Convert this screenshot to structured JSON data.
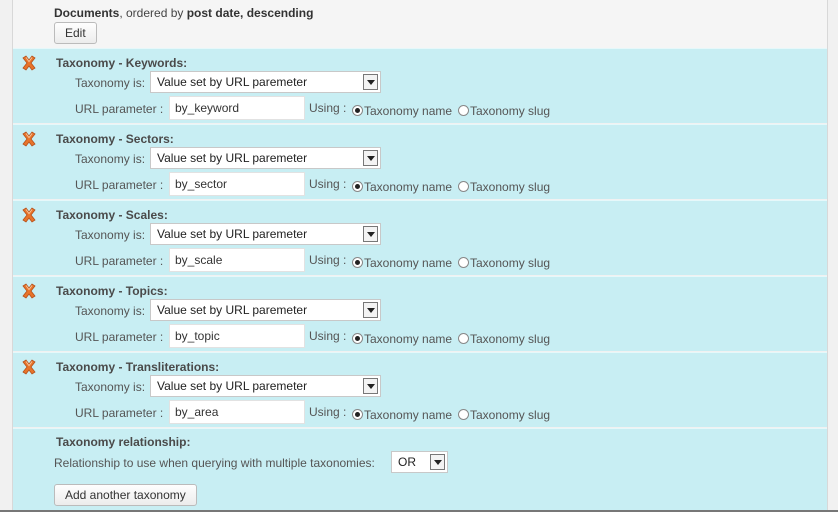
{
  "summary": {
    "post_type": "Documents",
    "ordered_by_text": ", ordered by ",
    "order_field": "post date, descending",
    "edit_label": "Edit"
  },
  "labels": {
    "taxonomy_is": "Taxonomy is:",
    "url_parameter": "URL parameter :",
    "using": "Using :",
    "taxonomy_name": "Taxonomy name",
    "taxonomy_slug": "Taxonomy slug"
  },
  "taxonomies": [
    {
      "title": "Taxonomy - Keywords:",
      "select_value": "Value set by URL paremeter",
      "url_param": "by_keyword",
      "using": "name"
    },
    {
      "title": "Taxonomy - Sectors:",
      "select_value": "Value set by URL paremeter",
      "url_param": "by_sector",
      "using": "name"
    },
    {
      "title": "Taxonomy - Scales:",
      "select_value": "Value set by URL paremeter",
      "url_param": "by_scale",
      "using": "name"
    },
    {
      "title": "Taxonomy - Topics:",
      "select_value": "Value set by URL paremeter",
      "url_param": "by_topic",
      "using": "name"
    },
    {
      "title": "Taxonomy - Transliterations:",
      "select_value": "Value set by URL paremeter",
      "url_param": "by_area",
      "using": "name"
    }
  ],
  "relationship": {
    "title": "Taxonomy relationship:",
    "label": "Relationship to use when querying with multiple taxonomies:",
    "value": "OR"
  },
  "add_button_label": "Add another taxonomy",
  "colors": {
    "block_bg": "#c8eef3",
    "page_bg": "#f1f1f1",
    "delete_icon": "#e8742a"
  }
}
